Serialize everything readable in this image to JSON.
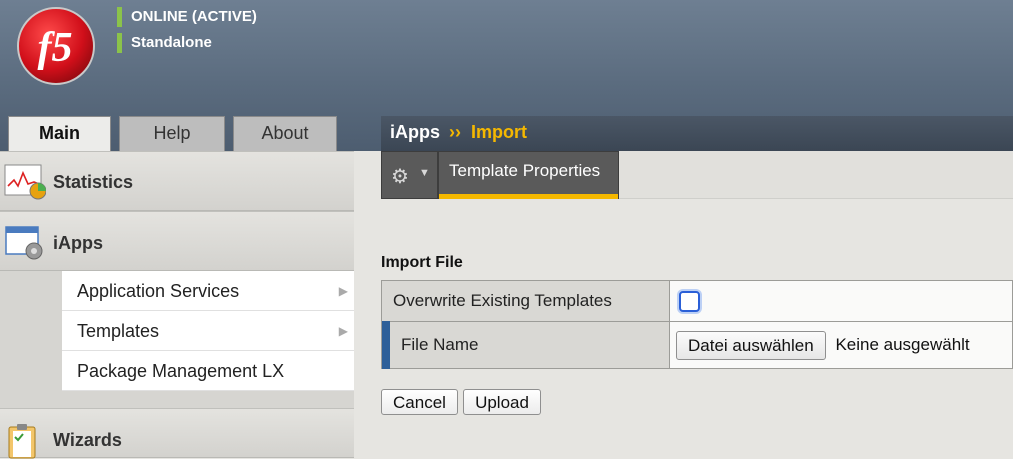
{
  "header": {
    "logo_text": "f5",
    "status_lines": [
      "ONLINE (ACTIVE)",
      "Standalone"
    ],
    "status_color": "#8bc34a"
  },
  "main_tabs": [
    {
      "label": "Main",
      "active": true
    },
    {
      "label": "Help",
      "active": false
    },
    {
      "label": "About",
      "active": false
    }
  ],
  "sidebar": {
    "sections": [
      {
        "label": "Statistics",
        "icon": "statistics-chart-icon"
      },
      {
        "label": "iApps",
        "icon": "iapps-gear-window-icon"
      },
      {
        "label": "Wizards",
        "icon": "wizards-clipboard-icon"
      }
    ],
    "submenu": [
      {
        "label": "Application Services",
        "has_arrow": true
      },
      {
        "label": "Templates",
        "has_arrow": true
      },
      {
        "label": "Package Management LX",
        "has_arrow": false
      }
    ]
  },
  "breadcrumb": {
    "parent": "iApps",
    "separator": "››",
    "current": "Import"
  },
  "subnav": {
    "gear_icon": "gear-icon",
    "tab_label": "Template Properties"
  },
  "form": {
    "section_title": "Import File",
    "rows": [
      {
        "label": "Overwrite Existing Templates",
        "type": "checkbox",
        "checked": false
      },
      {
        "label": "File Name",
        "type": "file",
        "button_label": "Datei auswählen",
        "status": "Keine ausgewählt"
      }
    ]
  },
  "buttons": {
    "cancel": "Cancel",
    "upload": "Upload"
  },
  "colors": {
    "accent": "#f5b800",
    "required_marker": "#2d5f99",
    "header_bg": "#5b6c7f"
  }
}
